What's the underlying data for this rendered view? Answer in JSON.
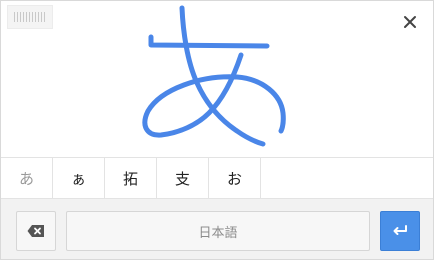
{
  "handwriting_panel": {
    "drag_handle_icon": "grip-lines-icon",
    "close_icon": "close-icon",
    "ink_color": "#4a86e8",
    "candidates": [
      {
        "label": "あ"
      },
      {
        "label": "ぁ"
      },
      {
        "label": "拓"
      },
      {
        "label": "支"
      },
      {
        "label": "お"
      }
    ]
  },
  "bottom_bar": {
    "backspace_icon": "backspace-icon",
    "language_label": "日本語",
    "enter_icon": "enter-icon",
    "enter_color": "#4a90e8"
  }
}
